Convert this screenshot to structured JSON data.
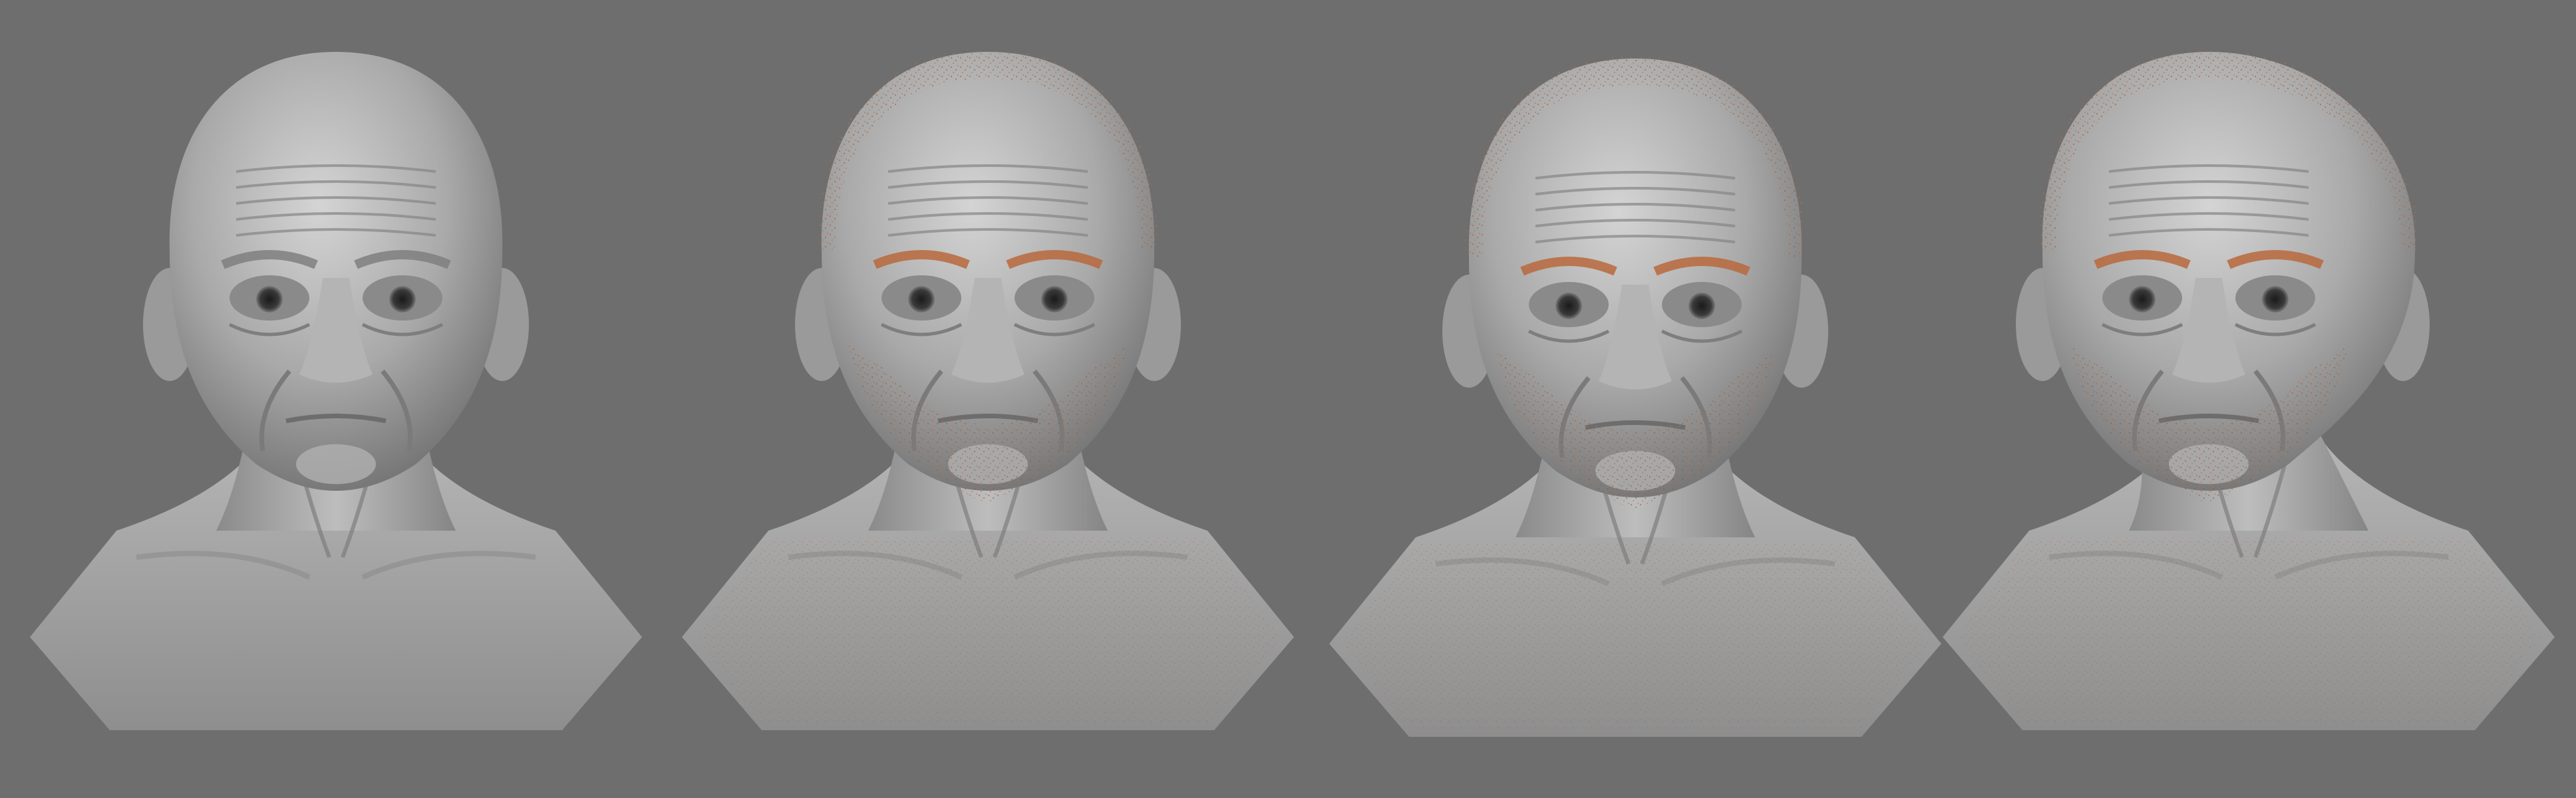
{
  "scene": {
    "background_color": "#6e6e6e",
    "clay_color": "#a8a8a8",
    "clay_shadow_color": "#6f6f6f",
    "clay_highlight_color": "#d8d8d8",
    "hair_color": "#b8683c",
    "hair_secondary_color": "#8a5a3e"
  },
  "renders": [
    {
      "name": "bust-render-front-no-hair",
      "view": "front",
      "hair": false,
      "yaw": 0
    },
    {
      "name": "bust-render-front-hair",
      "view": "front",
      "hair": true,
      "yaw": 0
    },
    {
      "name": "bust-render-front-tilted-hair",
      "view": "front-tilted",
      "hair": true,
      "yaw": 0
    },
    {
      "name": "bust-render-three-quarter-hair",
      "view": "three-quarter",
      "hair": true,
      "yaw": -1
    }
  ]
}
